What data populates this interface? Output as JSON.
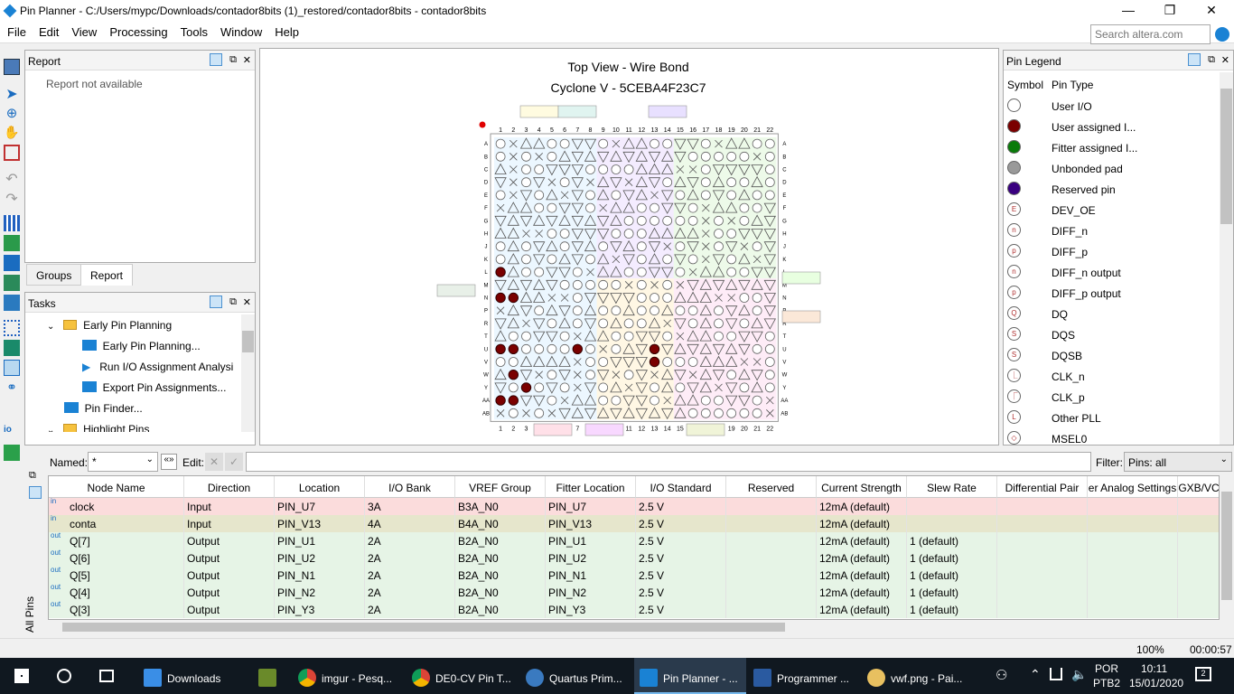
{
  "window": {
    "title": "Pin Planner - C:/Users/mypc/Downloads/contador8bits (1)_restored/contador8bits - contador8bits",
    "min": "—",
    "max": "❐",
    "close": "✕"
  },
  "menu": [
    "File",
    "Edit",
    "View",
    "Processing",
    "Tools",
    "Window",
    "Help"
  ],
  "search": {
    "placeholder": "Search altera.com"
  },
  "report": {
    "title": "Report",
    "empty": "Report not available"
  },
  "panel_tabs": [
    "Groups",
    "Report"
  ],
  "tasks": {
    "title": "Tasks",
    "items": [
      "Early Pin Planning",
      "Early Pin Planning...",
      "Run I/O Assignment Analysi",
      "Export Pin Assignments...",
      "Pin Finder...",
      "Highlight Pins"
    ]
  },
  "view": {
    "title": "Top View - Wire Bond",
    "subtitle": "Cyclone V - 5CEBA4F23C7",
    "cols": [
      "1",
      "2",
      "3",
      "4",
      "5",
      "6",
      "7",
      "8",
      "9",
      "10",
      "11",
      "12",
      "13",
      "14",
      "15",
      "16",
      "17",
      "18",
      "19",
      "20",
      "21",
      "22"
    ],
    "rows": [
      "A",
      "B",
      "C",
      "D",
      "E",
      "F",
      "G",
      "H",
      "J",
      "K",
      "L",
      "M",
      "N",
      "P",
      "R",
      "T",
      "U",
      "V",
      "W",
      "Y",
      "AA",
      "AB"
    ]
  },
  "legend": {
    "title": "Pin Legend",
    "col_symbol": "Symbol",
    "col_type": "Pin Type",
    "items": [
      {
        "label": "User I/O",
        "color": "#ffffff",
        "glyph": ""
      },
      {
        "label": "User assigned I...",
        "color": "#7a0000",
        "glyph": ""
      },
      {
        "label": "Fitter assigned I...",
        "color": "#0a7a0a",
        "glyph": ""
      },
      {
        "label": "Unbonded pad",
        "color": "#999999",
        "glyph": ""
      },
      {
        "label": "Reserved pin",
        "color": "#3a0080",
        "glyph": ""
      },
      {
        "label": "DEV_OE",
        "color": "#ffffff",
        "glyph": "E"
      },
      {
        "label": "DIFF_n",
        "color": "#ffffff",
        "glyph": "n"
      },
      {
        "label": "DIFF_p",
        "color": "#ffffff",
        "glyph": "p"
      },
      {
        "label": "DIFF_n output",
        "color": "#ffffff",
        "glyph": "n"
      },
      {
        "label": "DIFF_p output",
        "color": "#ffffff",
        "glyph": "p"
      },
      {
        "label": "DQ",
        "color": "#ffffff",
        "glyph": "Q"
      },
      {
        "label": "DQS",
        "color": "#ffffff",
        "glyph": "S"
      },
      {
        "label": "DQSB",
        "color": "#ffffff",
        "glyph": "S"
      },
      {
        "label": "CLK_n",
        "color": "#ffffff",
        "glyph": "⎿"
      },
      {
        "label": "CLK_p",
        "color": "#ffffff",
        "glyph": "⎾"
      },
      {
        "label": "Other PLL",
        "color": "#ffffff",
        "glyph": "L"
      },
      {
        "label": "MSEL0",
        "color": "#ffffff",
        "glyph": "◇"
      }
    ]
  },
  "filter": {
    "named_label": "Named:",
    "named_value": "*",
    "edit_label": "Edit:",
    "filter_label": "Filter:",
    "filter_value": "Pins: all",
    "side_label": "All Pins"
  },
  "table": {
    "columns": [
      "Node Name",
      "Direction",
      "Location",
      "I/O Bank",
      "VREF Group",
      "Fitter Location",
      "I/O Standard",
      "Reserved",
      "Current Strength",
      "Slew Rate",
      "Differential Pair",
      "er Analog Settings",
      "GXB/VC"
    ],
    "rows": [
      {
        "io": "in",
        "name": "clock",
        "dir": "Input",
        "loc": "PIN_U7",
        "bank": "3A",
        "vref": "B3A_N0",
        "fit": "PIN_U7",
        "std": "2.5 V",
        "res": "",
        "cur": "12mA (default)",
        "slew": "",
        "bg": "#fbdcdc"
      },
      {
        "io": "in",
        "name": "conta",
        "dir": "Input",
        "loc": "PIN_V13",
        "bank": "4A",
        "vref": "B4A_N0",
        "fit": "PIN_V13",
        "std": "2.5 V",
        "res": "",
        "cur": "12mA (default)",
        "slew": "",
        "bg": "#e6e6cc"
      },
      {
        "io": "out",
        "name": "Q[7]",
        "dir": "Output",
        "loc": "PIN_U1",
        "bank": "2A",
        "vref": "B2A_N0",
        "fit": "PIN_U1",
        "std": "2.5 V",
        "res": "",
        "cur": "12mA (default)",
        "slew": "1 (default)",
        "bg": "#e6f4e6"
      },
      {
        "io": "out",
        "name": "Q[6]",
        "dir": "Output",
        "loc": "PIN_U2",
        "bank": "2A",
        "vref": "B2A_N0",
        "fit": "PIN_U2",
        "std": "2.5 V",
        "res": "",
        "cur": "12mA (default)",
        "slew": "1 (default)",
        "bg": "#e6f4e6"
      },
      {
        "io": "out",
        "name": "Q[5]",
        "dir": "Output",
        "loc": "PIN_N1",
        "bank": "2A",
        "vref": "B2A_N0",
        "fit": "PIN_N1",
        "std": "2.5 V",
        "res": "",
        "cur": "12mA (default)",
        "slew": "1 (default)",
        "bg": "#e6f4e6"
      },
      {
        "io": "out",
        "name": "Q[4]",
        "dir": "Output",
        "loc": "PIN_N2",
        "bank": "2A",
        "vref": "B2A_N0",
        "fit": "PIN_N2",
        "std": "2.5 V",
        "res": "",
        "cur": "12mA (default)",
        "slew": "1 (default)",
        "bg": "#e6f4e6"
      },
      {
        "io": "out",
        "name": "Q[3]",
        "dir": "Output",
        "loc": "PIN_Y3",
        "bank": "2A",
        "vref": "B2A_N0",
        "fit": "PIN_Y3",
        "std": "2.5 V",
        "res": "",
        "cur": "12mA (default)",
        "slew": "1 (default)",
        "bg": "#e6f4e6"
      }
    ]
  },
  "status": {
    "zoom": "100%",
    "time": "00:00:57"
  },
  "taskbar": {
    "items": [
      "Downloads",
      "",
      "imgur - Pesq...",
      "DE0-CV Pin T...",
      "Quartus Prim...",
      "Pin Planner - ...",
      "Programmer ...",
      "vwf.png - Pai..."
    ],
    "lang": "POR",
    "layout": "PTB2",
    "clock": "10:11",
    "date": "15/01/2020",
    "notif": "2"
  }
}
